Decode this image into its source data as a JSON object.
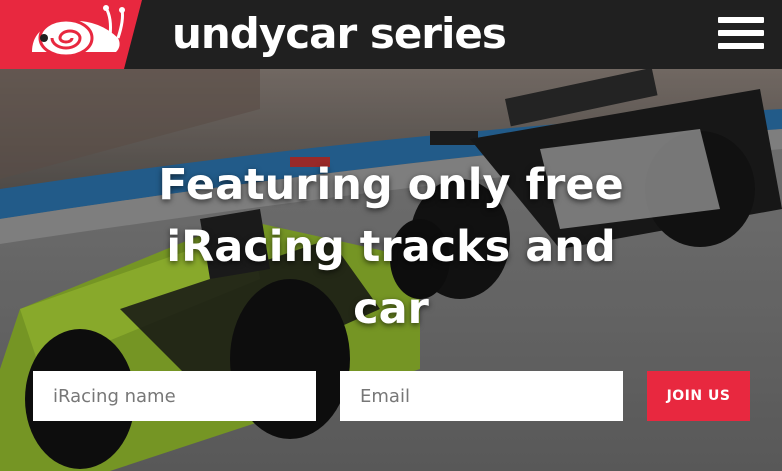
{
  "header": {
    "title": "undycar series",
    "logo_icon": "snail-icon",
    "menu_icon": "hamburger-menu-icon",
    "brand_color": "#e8283f"
  },
  "hero": {
    "headline": "Featuring only free iRacing tracks and car",
    "name_placeholder": "iRacing name",
    "email_placeholder": "Email",
    "join_label": "JOIN US",
    "join_color": "#e8283f"
  }
}
